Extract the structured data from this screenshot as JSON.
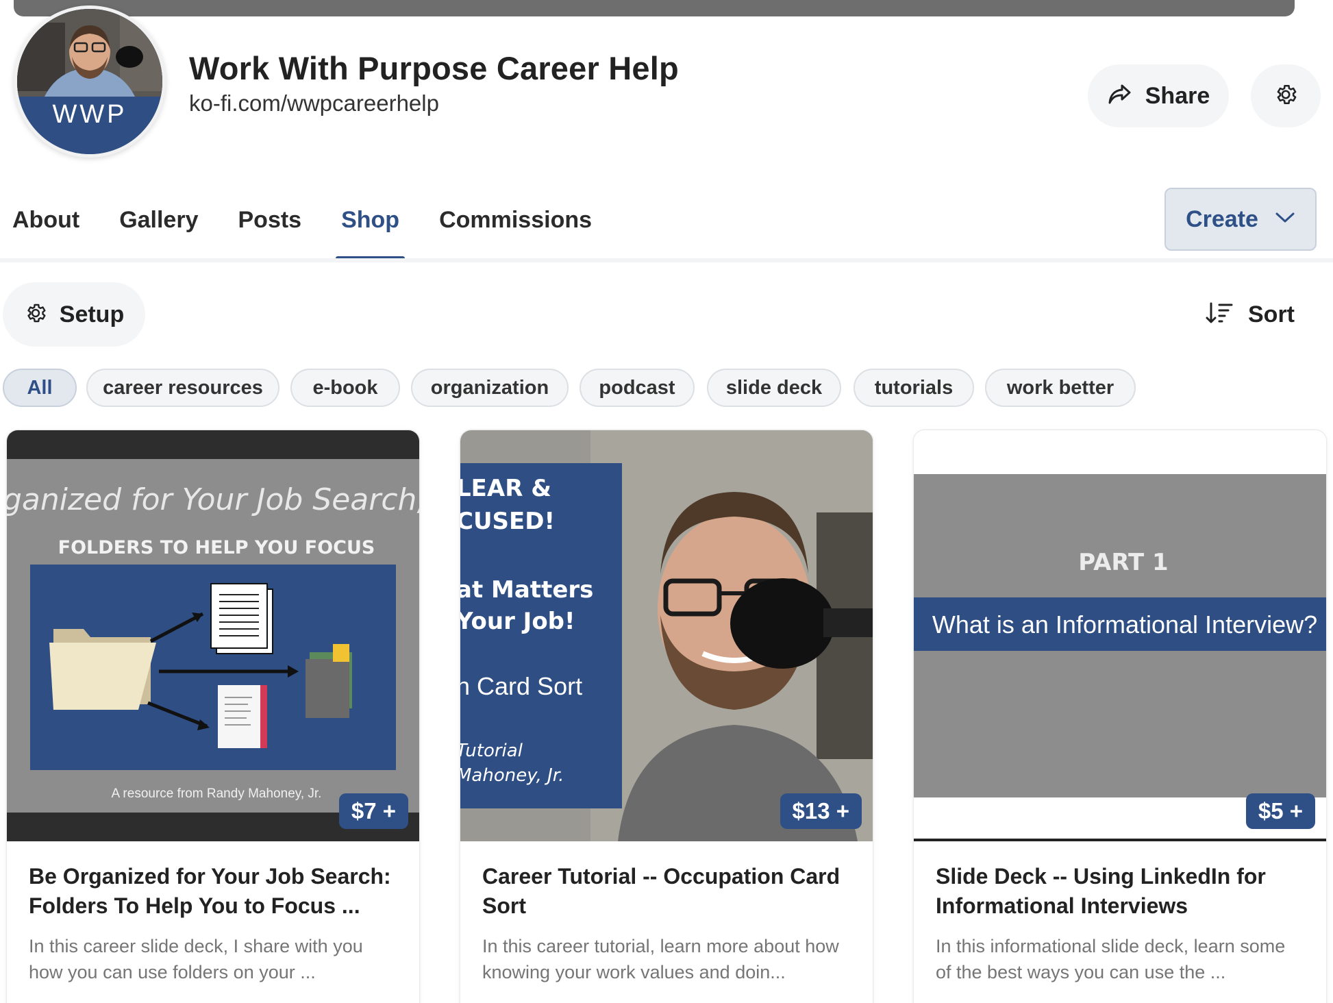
{
  "profile": {
    "avatar_initials": "WWP",
    "name": "Work With Purpose Career Help",
    "url": "ko-fi.com/wwpcareerhelp",
    "share_label": "Share"
  },
  "tabs": [
    {
      "label": "About"
    },
    {
      "label": "Gallery"
    },
    {
      "label": "Posts"
    },
    {
      "label": "Shop",
      "active": true
    },
    {
      "label": "Commissions"
    }
  ],
  "create_label": "Create",
  "toolbar": {
    "setup_label": "Setup",
    "sort_label": "Sort"
  },
  "filters": [
    "All",
    "career resources",
    "e-book",
    "organization",
    "podcast",
    "slide deck",
    "tutorials",
    "work better"
  ],
  "active_filter": "All",
  "colors": {
    "accent": "#2f5087",
    "chip_bg": "#f4f5f6",
    "thumb_navy": "#2f4f84"
  },
  "products": [
    {
      "price": "$7 +",
      "title": "Be Organized for Your Job Search: Folders To Help You to Focus ...",
      "description": "In this career slide deck, I share with you how you can use folders on your ...",
      "thumb": {
        "headline": "ganized for Your Job Search, I",
        "subhead": "FOLDERS TO HELP YOU FOCUS",
        "credit": "A resource from Randy Mahoney, Jr."
      }
    },
    {
      "price": "$13 +",
      "title": "Career Tutorial -- Occupation Card Sort",
      "description": "In this career tutorial, learn more about how knowing your work values and doin...",
      "thumb": {
        "line1": "LEAR &",
        "line2": "CUSED!",
        "line3": "at Matters",
        "line4": "Your Job!",
        "line5": "n Card Sort",
        "line6": "Tutorial",
        "line7": "Mahoney, Jr."
      }
    },
    {
      "price": "$5 +",
      "title": "Slide Deck -- Using LinkedIn for Informational Interviews",
      "description": "In this informational slide deck, learn some of the best ways you can use the ...",
      "thumb": {
        "part": "PART 1",
        "question": "What is an Informational Interview?"
      }
    }
  ]
}
